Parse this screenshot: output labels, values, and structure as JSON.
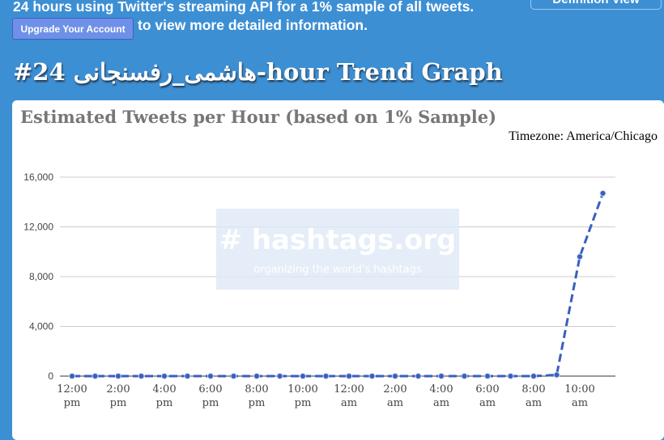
{
  "header": {
    "intro_line1": "24 hours using Twitter's streaming API for a 1% sample of all tweets.",
    "upgrade_button": "Upgrade Your Account",
    "intro_line2": "to view more detailed information.",
    "definition_button": "Definition View",
    "page_title": "#24 هاشمی_رفسنجانی-hour Trend Graph"
  },
  "panel": {
    "title": "Estimated Tweets per Hour (based on 1% Sample)",
    "timezone": "Timezone: America/Chicago",
    "watermark_main": "# hashtags.org",
    "watermark_sub": "organizing the world's hashtags"
  },
  "colors": {
    "background": "#3d8fd4",
    "line": "#3a5fbf"
  },
  "chart_data": {
    "type": "line",
    "ylim": [
      0,
      16000
    ],
    "yticks": [
      "0",
      "4,000",
      "8,000",
      "12,000",
      "16,000"
    ],
    "xtick_labels": [
      [
        "12:00",
        "pm"
      ],
      [
        "2:00",
        "pm"
      ],
      [
        "4:00",
        "pm"
      ],
      [
        "6:00",
        "pm"
      ],
      [
        "8:00",
        "pm"
      ],
      [
        "10:00",
        "pm"
      ],
      [
        "12:00",
        "am"
      ],
      [
        "2:00",
        "am"
      ],
      [
        "4:00",
        "am"
      ],
      [
        "6:00",
        "am"
      ],
      [
        "8:00",
        "am"
      ],
      [
        "10:00",
        "am"
      ]
    ],
    "x": [
      "12pm",
      "1pm",
      "2pm",
      "3pm",
      "4pm",
      "5pm",
      "6pm",
      "7pm",
      "8pm",
      "9pm",
      "10pm",
      "11pm",
      "12am",
      "1am",
      "2am",
      "3am",
      "4am",
      "5am",
      "6am",
      "7am",
      "8am",
      "9am",
      "10am",
      "11am"
    ],
    "values": [
      0,
      0,
      0,
      0,
      0,
      0,
      0,
      0,
      0,
      0,
      0,
      0,
      0,
      0,
      0,
      0,
      0,
      0,
      0,
      0,
      0,
      100,
      9600,
      14700
    ],
    "line_style": "dashed",
    "grid": true
  }
}
